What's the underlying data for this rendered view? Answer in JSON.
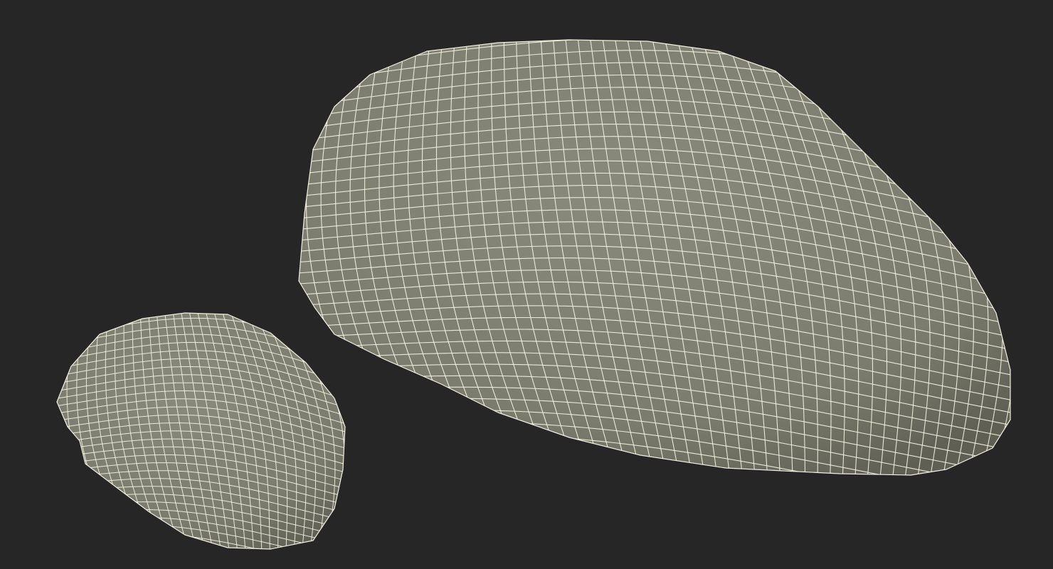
{
  "scene": {
    "background_color": "#262626",
    "mesh_fill_color": "#7c7c6e",
    "mesh_shade_color": "#5f5f54",
    "mesh_highlight_color": "#8a8a7c",
    "wire_color": "#f4f1e0",
    "objects": [
      {
        "name": "large-stone",
        "render_style": "wireframe-on-shaded"
      },
      {
        "name": "small-stone",
        "render_style": "wireframe-on-shaded"
      }
    ]
  }
}
